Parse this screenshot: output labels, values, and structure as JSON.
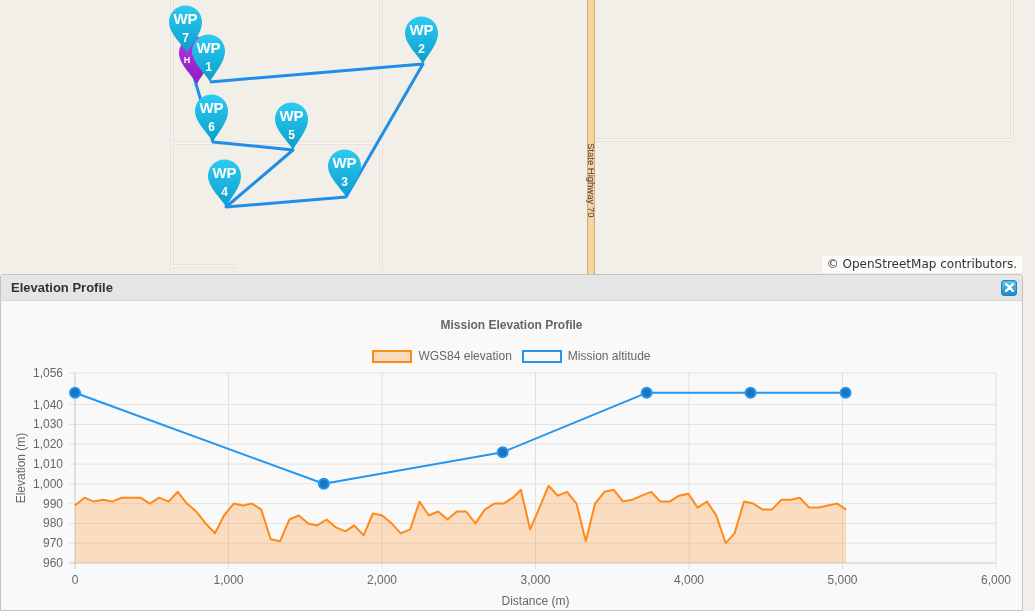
{
  "map": {
    "home_marker": {
      "label": "H"
    },
    "waypoints": [
      {
        "label": "WP",
        "number": "1"
      },
      {
        "label": "WP",
        "number": "2"
      },
      {
        "label": "WP",
        "number": "3"
      },
      {
        "label": "WP",
        "number": "4"
      },
      {
        "label": "WP",
        "number": "5"
      },
      {
        "label": "WP",
        "number": "6"
      },
      {
        "label": "WP",
        "number": "7"
      }
    ],
    "road_label": "State Highway 70",
    "attribution": "© OpenStreetMap contributors."
  },
  "elevation_panel": {
    "title": "Elevation Profile",
    "chart_data": {
      "type": "line",
      "title": "Mission Elevation Profile",
      "xlabel": "Distance (m)",
      "ylabel": "Elevation (m)",
      "legend": "top",
      "grid": true,
      "series": [
        {
          "name": "WGS84 elevation",
          "color": "#ff8a1a",
          "type": "area",
          "x": [
            0,
            61,
            122,
            181,
            242,
            305,
            366,
            427,
            487,
            548,
            609,
            670,
            729,
            790,
            851,
            912,
            971,
            1034,
            1095,
            1153,
            1214,
            1275,
            1336,
            1397,
            1458,
            1519,
            1578,
            1639,
            1700,
            1761,
            1819,
            1880,
            1941,
            2002,
            2063,
            2122,
            2183,
            2244,
            2305,
            2366,
            2427,
            2487,
            2548,
            2609,
            2670,
            2731,
            2792,
            2853,
            2905,
            2965,
            3026,
            3085,
            3145,
            3206,
            3267,
            3328,
            3388,
            3449,
            3510,
            3570,
            3631,
            3692,
            3753,
            3813,
            3874,
            3935,
            3996,
            4056,
            4117,
            4178,
            4239,
            4297,
            4358,
            4419,
            4479,
            4540,
            4601,
            4662,
            4722,
            4783,
            4844,
            4905,
            4965,
            5024
          ],
          "values": [
            989,
            993,
            991,
            992,
            991,
            993,
            993,
            993,
            990,
            993,
            991,
            996,
            990,
            986,
            980,
            975,
            984,
            990,
            989,
            990,
            987,
            972,
            971,
            982,
            984,
            980,
            979,
            982,
            978,
            976,
            979,
            974,
            985,
            984,
            980,
            975,
            977,
            991,
            984,
            986,
            982,
            986,
            986,
            980,
            987,
            990,
            990,
            993,
            997,
            977,
            988,
            999,
            994,
            996,
            990,
            971,
            990,
            996,
            997,
            991,
            992,
            994,
            996,
            991,
            991,
            994,
            995,
            988,
            991,
            984,
            970,
            975,
            991,
            990,
            987,
            987,
            992,
            992,
            993,
            988,
            988,
            989,
            990,
            987
          ]
        },
        {
          "name": "Mission altitude",
          "color": "#2196f3",
          "type": "line",
          "marker": "circle",
          "x": [
            0,
            1621,
            2786,
            3724,
            4401,
            5020
          ],
          "values": [
            1046,
            1000,
            1016,
            1046,
            1046,
            1046
          ]
        }
      ],
      "xlim": [
        0,
        6000
      ],
      "ylim": [
        960,
        1056
      ],
      "xticks": [
        {
          "value": 0,
          "label": "0"
        },
        {
          "value": 1000,
          "label": "1,000"
        },
        {
          "value": 2000,
          "label": "2,000"
        },
        {
          "value": 3000,
          "label": "3,000"
        },
        {
          "value": 4000,
          "label": "4,000"
        },
        {
          "value": 5000,
          "label": "5,000"
        },
        {
          "value": 6000,
          "label": "6,000"
        }
      ],
      "yticks": [
        {
          "value": 960,
          "label": "960"
        },
        {
          "value": 970,
          "label": "970"
        },
        {
          "value": 980,
          "label": "980"
        },
        {
          "value": 990,
          "label": "990"
        },
        {
          "value": 1000,
          "label": "1,000"
        },
        {
          "value": 1010,
          "label": "1,010"
        },
        {
          "value": 1020,
          "label": "1,020"
        },
        {
          "value": 1030,
          "label": "1,030"
        },
        {
          "value": 1040,
          "label": "1,040"
        },
        {
          "value": 1056,
          "label": "1,056"
        }
      ]
    }
  }
}
